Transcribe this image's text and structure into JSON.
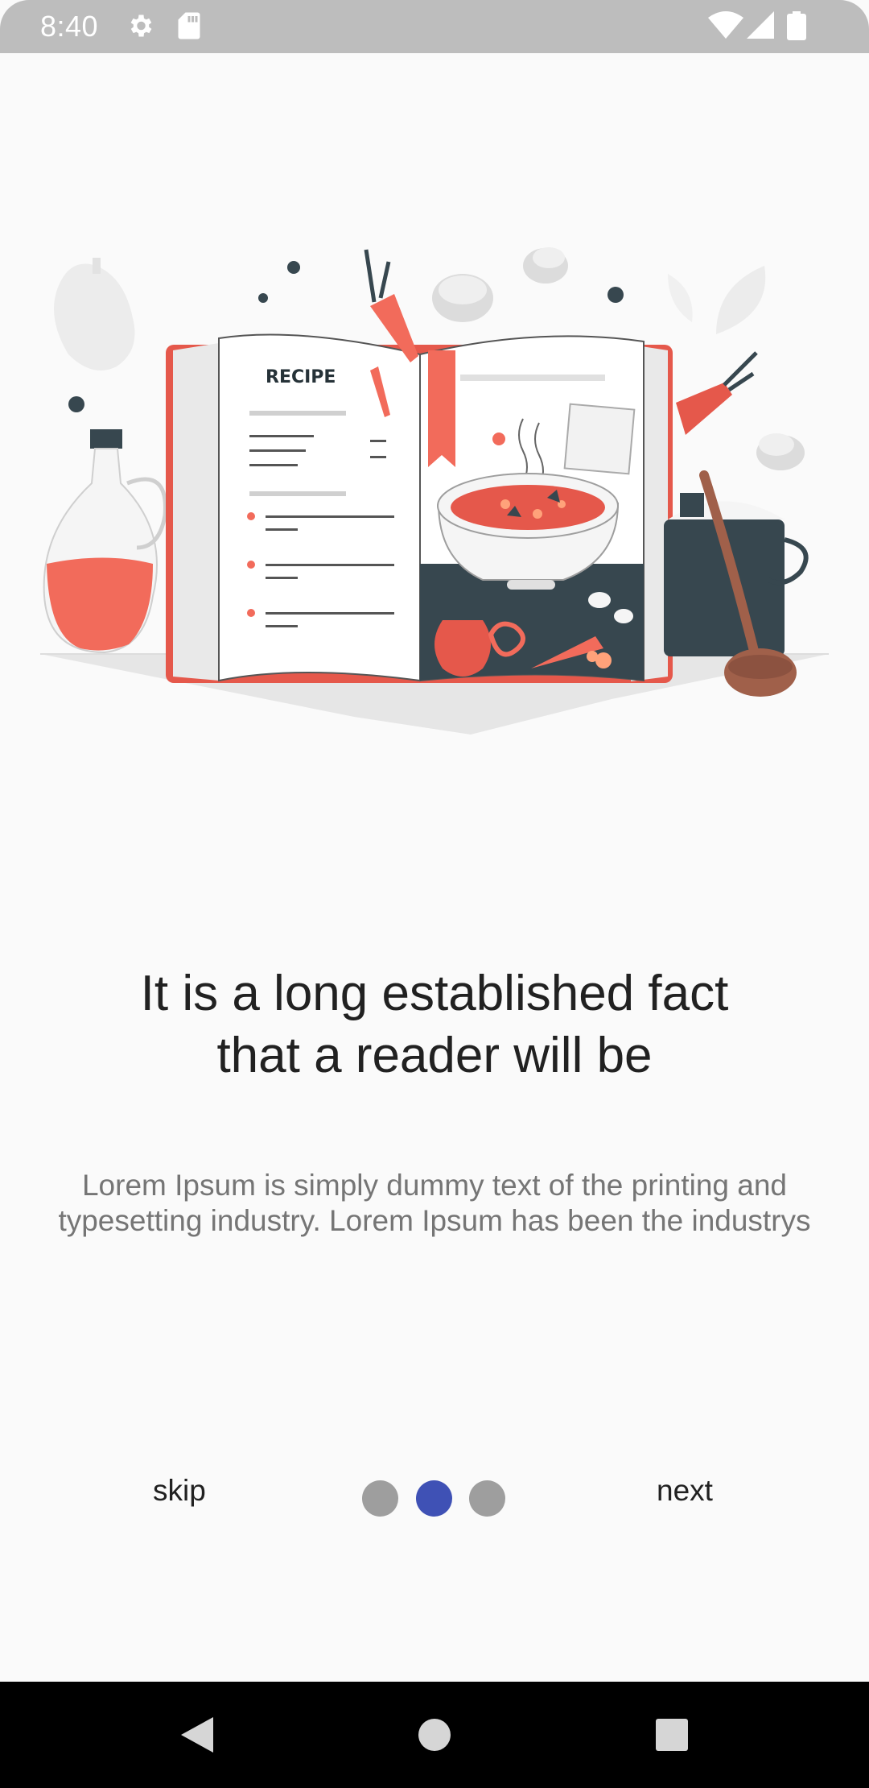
{
  "status_bar": {
    "time": "8:40",
    "icons": [
      "settings-icon",
      "sd-card-icon",
      "wifi-icon",
      "signal-icon",
      "battery-icon"
    ]
  },
  "illustration": {
    "label": "RECIPE",
    "colors": {
      "accent": "#f26b5b",
      "dark": "#37474f",
      "gray": "#e0e0e0",
      "ladle": "#a0604a"
    }
  },
  "onboarding": {
    "title_line1": "It is a long established fact",
    "title_line2": "that a reader will be",
    "body_line1": "Lorem Ipsum is simply dummy text of the printing and",
    "body_line2": "typesetting industry. Lorem Ipsum has been the industrys"
  },
  "controls": {
    "skip_label": "skip",
    "next_label": "next",
    "page_count": 3,
    "active_page": 2,
    "dot_color": "#9e9e9e",
    "active_dot_color": "#3f51b5"
  },
  "nav_bar": {
    "buttons": [
      "back-icon",
      "home-icon",
      "recents-icon"
    ]
  }
}
